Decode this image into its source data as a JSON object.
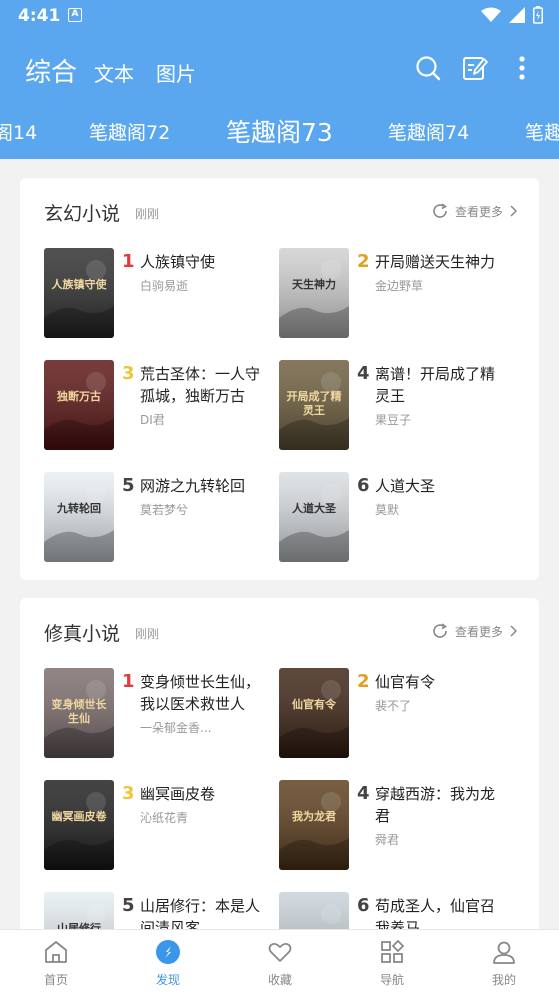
{
  "status_bar": {
    "time": "4:41",
    "notif_letter": "A"
  },
  "header": {
    "tabs": [
      "综合",
      "文本",
      "图片"
    ]
  },
  "sources": [
    "阁14",
    "笔趣阁72",
    "笔趣阁73",
    "笔趣阁74",
    "笔趣"
  ],
  "sections": [
    {
      "title": "玄幻小说",
      "time": "刚刚",
      "more": "查看更多",
      "books": [
        {
          "rank": "1",
          "name": "人族镇守使",
          "author": "白驹易逝",
          "cover_text": "人族镇守使",
          "cover_color": "#2a2a2a"
        },
        {
          "rank": "2",
          "name": "开局赠送天生神力",
          "author": "金边野草",
          "cover_text": "天生神力",
          "cover_color": "#cfcfcf"
        },
        {
          "rank": "3",
          "name": "荒古圣体：一人守孤城，独断万古",
          "author": "DI君",
          "cover_text": "独断万古",
          "cover_color": "#5a1010"
        },
        {
          "rank": "4",
          "name": "离谱！开局成了精灵王",
          "author": "果豆子",
          "cover_text": "开局成了精灵王",
          "cover_color": "#6a5a3a"
        },
        {
          "rank": "5",
          "name": "网游之九转轮回",
          "author": "莫若梦兮",
          "cover_text": "九转轮回",
          "cover_color": "#e8eef4"
        },
        {
          "rank": "6",
          "name": "人道大圣",
          "author": "莫默",
          "cover_text": "人道大圣",
          "cover_color": "#d8dde0"
        }
      ]
    },
    {
      "title": "修真小说",
      "time": "刚刚",
      "more": "查看更多",
      "books": [
        {
          "rank": "1",
          "name": "变身倾世长生仙，我以医术救世人",
          "author": "一朵郁金香...",
          "cover_text": "变身倾世长生仙",
          "cover_color": "#7a6a6a"
        },
        {
          "rank": "2",
          "name": "仙官有令",
          "author": "裴不了",
          "cover_text": "仙官有令",
          "cover_color": "#3a2010"
        },
        {
          "rank": "3",
          "name": "幽冥画皮卷",
          "author": "沁纸花青",
          "cover_text": "幽冥画皮卷",
          "cover_color": "#1a1a1a"
        },
        {
          "rank": "4",
          "name": "穿越西游：我为龙君",
          "author": "舜君",
          "cover_text": "我为龙君",
          "cover_color": "#5a3a18"
        },
        {
          "rank": "5",
          "name": "山居修行：本是人间清风客",
          "author": "",
          "cover_text": "山居修行",
          "cover_color": "#e6eef0"
        },
        {
          "rank": "6",
          "name": "苟成圣人，仙官召我养马",
          "author": "",
          "cover_text": "",
          "cover_color": "#c8d2d8"
        }
      ]
    }
  ],
  "tabbar": {
    "items": [
      "首页",
      "发现",
      "收藏",
      "导航",
      "我的"
    ],
    "active": "发现"
  },
  "colors": {
    "accent": "#5aa7f0",
    "active_tab": "#3b95e8"
  },
  "icons": [
    "search-icon",
    "edit-icon",
    "more-vert-icon",
    "refresh-icon",
    "chevron-right-icon",
    "home-icon",
    "compass-icon",
    "heart-icon",
    "grid-icon",
    "user-icon"
  ]
}
